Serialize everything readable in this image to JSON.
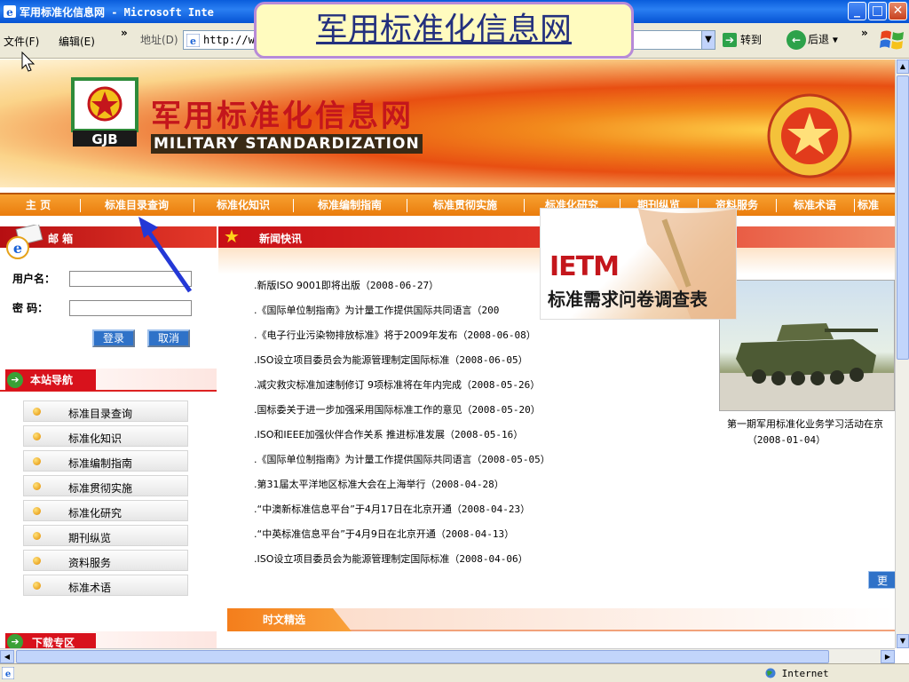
{
  "window": {
    "title": "军用标准化信息网 - Microsoft Inte",
    "min": "_",
    "max": "□",
    "close": "✕"
  },
  "toolbar": {
    "menu_file": "文件(F)",
    "menu_edit": "编辑(E)",
    "more": "»",
    "more2": "»",
    "address_label": "地址(D)",
    "address_value": "http://w",
    "dropdown": "▼",
    "go_arrow": "➔",
    "go_label": "转到",
    "back_arrow": "←",
    "back_label": "后退",
    "back_dropdown": "▾"
  },
  "overlay": {
    "title": "军用标准化信息网"
  },
  "banner": {
    "logo_text": "GJB",
    "site_name_cn": "军用标准化信息网",
    "site_name_en": "MILITARY STANDARDIZATION"
  },
  "nav": {
    "items": [
      "主 页",
      "标准目录查询",
      "标准化知识",
      "标准编制指南",
      "标准贯彻实施",
      "标准化研究",
      "期刊纵览",
      "资料服务",
      "标准术语",
      "标准"
    ]
  },
  "mailbox": {
    "title": "邮 箱",
    "username_label": "用户名：",
    "password_label": "密  码：",
    "login": "登录",
    "cancel": "取消"
  },
  "site_nav": {
    "title": "本站导航",
    "icon": "➔",
    "items": [
      "标准目录查询",
      "标准化知识",
      "标准编制指南",
      "标准贯彻实施",
      "标准化研究",
      "期刊纵览",
      "资料服务",
      "标准术语"
    ]
  },
  "download": {
    "title": "下载专区",
    "icon": "➔"
  },
  "news": {
    "title": "新闻快讯",
    "star": "★",
    "items": [
      {
        "title": ".新版ISO 9001即将出版",
        "date": "（2008-06-27）"
      },
      {
        "title": ".《国际单位制指南》为计量工作提供国际共同语言",
        "date": "（200"
      },
      {
        "title": ".《电子行业污染物排放标准》将于2009年发布",
        "date": "（2008-06-08）"
      },
      {
        "title": ".ISO设立项目委员会为能源管理制定国际标准",
        "date": "（2008-06-05）"
      },
      {
        "title": ".减灾救灾标准加速制修订 9项标准将在年内完成",
        "date": "（2008-05-26）"
      },
      {
        "title": ".国标委关于进一步加强采用国际标准工作的意见",
        "date": "（2008-05-20）"
      },
      {
        "title": ".ISO和IEEE加强伙伴合作关系 推进标准发展",
        "date": "（2008-05-16）"
      },
      {
        "title": ".《国际单位制指南》为计量工作提供国际共同语言",
        "date": "（2008-05-05）"
      },
      {
        "title": ".第31届太平洋地区标准大会在上海举行",
        "date": "（2008-04-28）"
      },
      {
        "title": ".“中澳新标准信息平台”于4月17日在北京开通",
        "date": "（2008-04-23）"
      },
      {
        "title": ".“中英标准信息平台”于4月9日在北京开通",
        "date": "（2008-04-13）"
      },
      {
        "title": ".ISO设立项目委员会为能源管理制定国际标准",
        "date": "（2008-04-06）"
      }
    ],
    "more": "更"
  },
  "photo": {
    "caption": "第一期军用标准化业务学习活动在京",
    "date": "（2008-01-04）"
  },
  "ietm": {
    "big": "IETM",
    "sub": "标准需求问卷调查表"
  },
  "selection": {
    "title": "时文精选"
  },
  "status": {
    "zone": "Internet"
  },
  "scroll": {
    "up": "▲",
    "down": "▼",
    "left": "◀",
    "right": "▶"
  },
  "colors": {
    "nav_orange": "#ea7c0c",
    "header_red": "#c80f16",
    "link_blue": "#2f72c8"
  }
}
